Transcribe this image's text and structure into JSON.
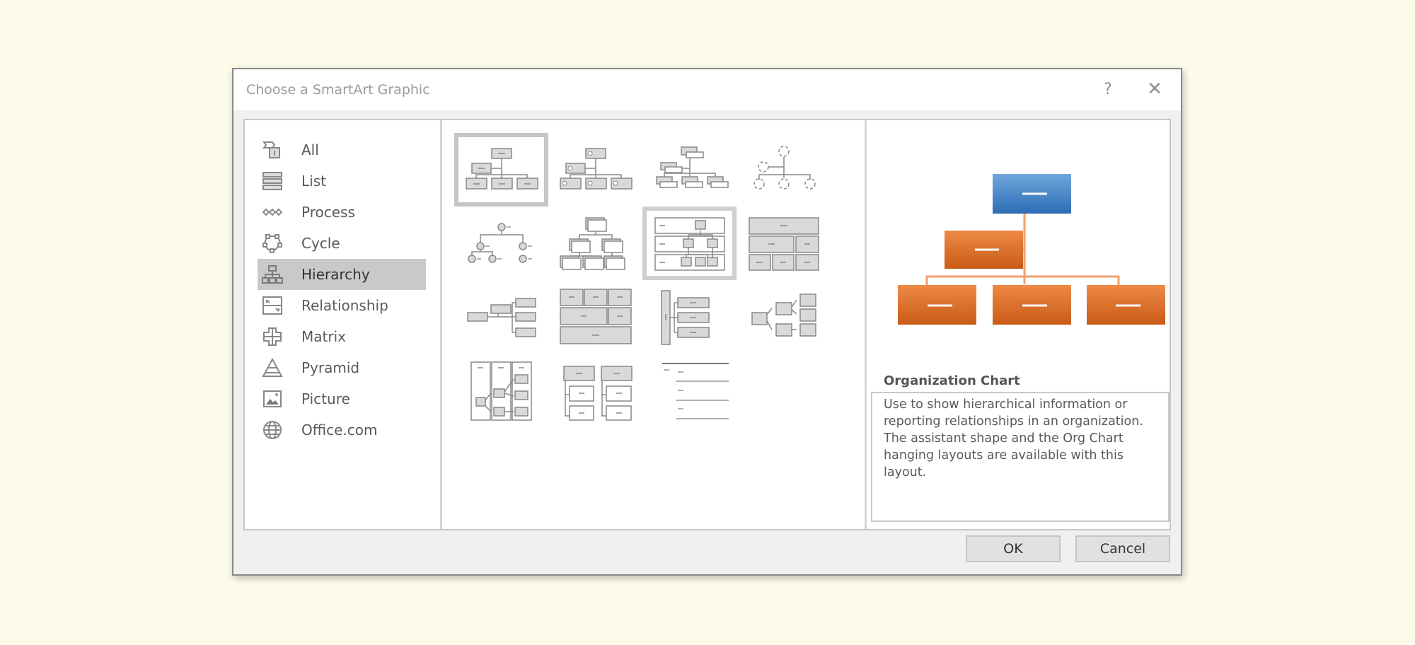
{
  "dialog": {
    "title": "Choose a SmartArt Graphic",
    "help_label": "?",
    "close_label": "✕"
  },
  "categories": [
    {
      "label": "All",
      "icon": "all-icon"
    },
    {
      "label": "List",
      "icon": "list-icon"
    },
    {
      "label": "Process",
      "icon": "process-icon"
    },
    {
      "label": "Cycle",
      "icon": "cycle-icon"
    },
    {
      "label": "Hierarchy",
      "icon": "hierarchy-icon",
      "selected": true
    },
    {
      "label": "Relationship",
      "icon": "relationship-icon"
    },
    {
      "label": "Matrix",
      "icon": "matrix-icon"
    },
    {
      "label": "Pyramid",
      "icon": "pyramid-icon"
    },
    {
      "label": "Picture",
      "icon": "picture-icon"
    },
    {
      "label": "Office.com",
      "icon": "globe-icon"
    }
  ],
  "gallery": {
    "selected_index": 0,
    "hover_index": 6,
    "layouts": [
      "organization-chart",
      "picture-organization-chart",
      "name-and-title-organization-chart",
      "circle-picture-hierarchy",
      "labeled-circle-hierarchy",
      "stacked-hierarchy",
      "horizontal-labeled-hierarchy",
      "table-hierarchy",
      "horizontal-hierarchy",
      "architecture-layout",
      "hierarchy-list",
      "horizontal-multi-level-hierarchy",
      "lined-list-hierarchy",
      "hierarchy-columns",
      "lined-list"
    ]
  },
  "preview": {
    "layout_name": "Organization Chart",
    "description": "Use to show hierarchical information or reporting relationships in an organization. The assistant shape and the Org Chart hanging layouts are available with this layout.",
    "colors": {
      "top": "#3f7fc4",
      "child": "#dd6d24",
      "connector": "#f0a070"
    }
  },
  "buttons": {
    "ok_label": "OK",
    "cancel_label": "Cancel"
  }
}
